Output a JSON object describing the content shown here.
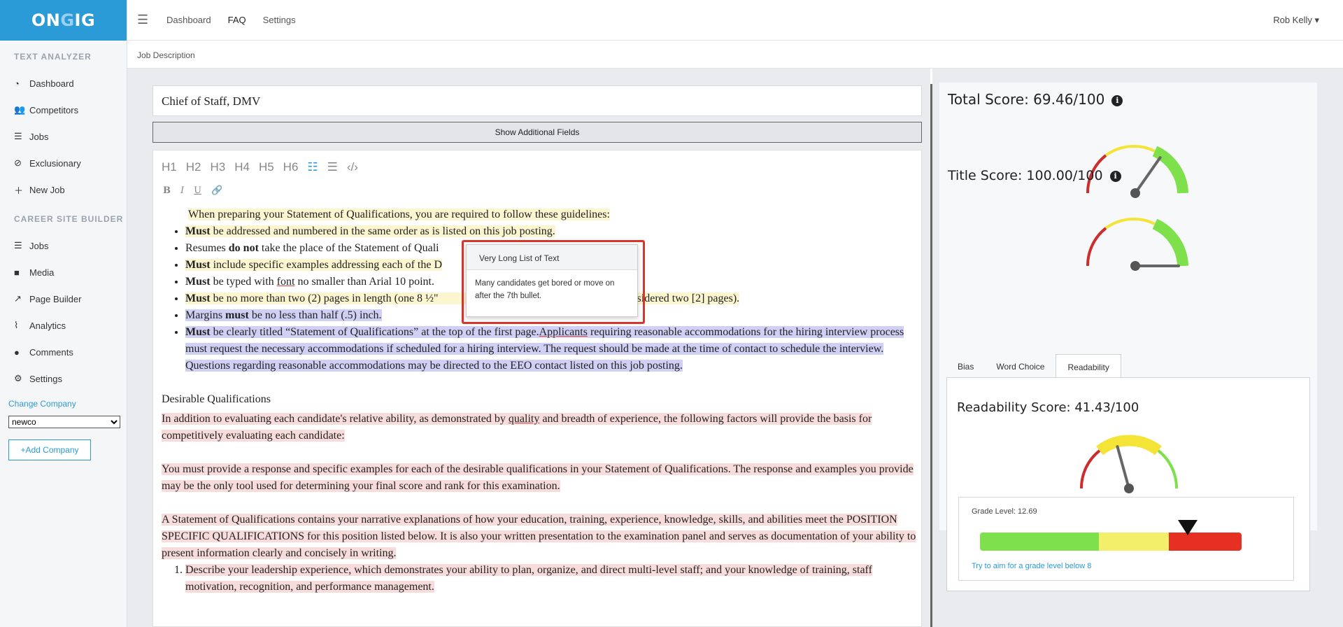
{
  "logo": {
    "part1": "ON",
    "part2": "G",
    "part3": "IG"
  },
  "sidebar": {
    "text_analyzer_heading": "TEXT ANALYZER",
    "text_analyzer_items": [
      {
        "label": "Dashboard",
        "icon": "tachometer-icon"
      },
      {
        "label": "Competitors",
        "icon": "users-icon"
      },
      {
        "label": "Jobs",
        "icon": "list-icon"
      },
      {
        "label": "Exclusionary",
        "icon": "ban-icon"
      },
      {
        "label": "New Job",
        "icon": "plus-icon"
      }
    ],
    "career_heading": "CAREER SITE BUILDER",
    "career_items": [
      {
        "label": "Jobs",
        "icon": "list-icon"
      },
      {
        "label": "Media",
        "icon": "video-icon"
      },
      {
        "label": "Page Builder",
        "icon": "magic-icon"
      },
      {
        "label": "Analytics",
        "icon": "line-chart-icon"
      },
      {
        "label": "Comments",
        "icon": "comment-icon"
      },
      {
        "label": "Settings",
        "icon": "gear-icon"
      }
    ],
    "change_company": "Change Company",
    "company_selected": "newco",
    "add_company": "+Add Company"
  },
  "topnav": {
    "links": [
      "Dashboard",
      "FAQ",
      "Settings"
    ],
    "active": "FAQ",
    "user": "Rob Kelly ▾"
  },
  "breadcrumb": "Job Description",
  "job_title": "Chief of Staff, DMV",
  "show_fields": "Show Additional Fields",
  "toolbar": {
    "headings": [
      "H1",
      "H2",
      "H3",
      "H4",
      "H5",
      "H6"
    ],
    "format": [
      "B",
      "I",
      "U"
    ]
  },
  "content": {
    "intro": "When preparing your Statement of Qualifications, you are required to follow these guidelines:",
    "b1_strong": "Must",
    "b1": " be addressed and numbered in the same order as is listed on this job posting.",
    "b2_pre": "Resumes ",
    "b2_strong": "do not",
    "b2": " take the place of the Statement of Quali",
    "b3_strong": "Must",
    "b3": " include specific examples addressing each of the D",
    "b4_strong": "Must",
    "b4_pre": " be typed with ",
    "b4_ul": "font",
    "b4": " no smaller than Arial 10 point.",
    "b5_strong": "Must",
    "b5": " be no more than two (2) pages in length (one 8 ½\"",
    "b5_tail": "d back is considered two [2] pages).",
    "b6_pre": "Margins ",
    "b6_strong": "must",
    "b6": " be no less than half (.5) inch.",
    "b7_strong": "Must",
    "b7": " be clearly titled “Statement of Qualifications” at the top of the first page.",
    "b7_ul": "Applicants",
    "b7_rest": " requiring reasonable accommodations for the hiring interview process must request the necessary accommodations if scheduled for a hiring interview. The request should be made at the time of contact to schedule the interview. Questions regarding reasonable accommodations may be directed to the EEO contact listed on this job posting.",
    "desirable_heading": "Desirable Qualifications",
    "p1_pre": " In addition to evaluating each candidate's relative ability, as demonstrated by ",
    "p1_ul": "quality",
    "p1_rest": " and breadth of experience, the following factors will provide the basis for competitively evaluating each candidate:",
    "p2": "You must provide a response and specific examples for each of the desirable qualifications in your Statement of Qualifications.  The response and examples you provide may be the only tool used for determining your final score and rank for this examination.",
    "p3": " A Statement of Qualifications contains your narrative explanations of how your education, training, experience, knowledge, skills, and abilities meet the POSITION SPECIFIC QUALIFICATIONS for this position listed below.  It is also your written presentation to the examination panel and serves as documentation of your ability to present information clearly and concisely in writing.",
    "ol1": "Describe your leadership experience, which demonstrates your ability to plan, organize, and direct multi-level staff; and your knowledge of training, staff motivation, recognition, and performance management."
  },
  "tooltip": {
    "title": "Very Long List of Text",
    "body": "Many candidates get bored or move on after the 7th bullet."
  },
  "scores": {
    "total_label": "Total Score: 69.46/100",
    "total_value": 69.46,
    "title_label": "Title Score: 100.00/100",
    "title_value": 100.0,
    "readability_label": "Readability Score: 41.43/100",
    "readability_value": 41.43
  },
  "tabs": [
    "Bias",
    "Word Choice",
    "Readability"
  ],
  "active_tab": "Readability",
  "grade": {
    "label": "Grade Level: 12.69",
    "value": 12.69,
    "tip": "Try to aim for a grade level below 8"
  },
  "colors": {
    "brand": "#2a9bd6",
    "gauge_red": "#cc2e2e",
    "gauge_yellow": "#f4e437",
    "gauge_green": "#7ee04a",
    "bar_green": "#7ee04a",
    "bar_yellow": "#f4ef6a",
    "bar_red": "#e63023"
  }
}
